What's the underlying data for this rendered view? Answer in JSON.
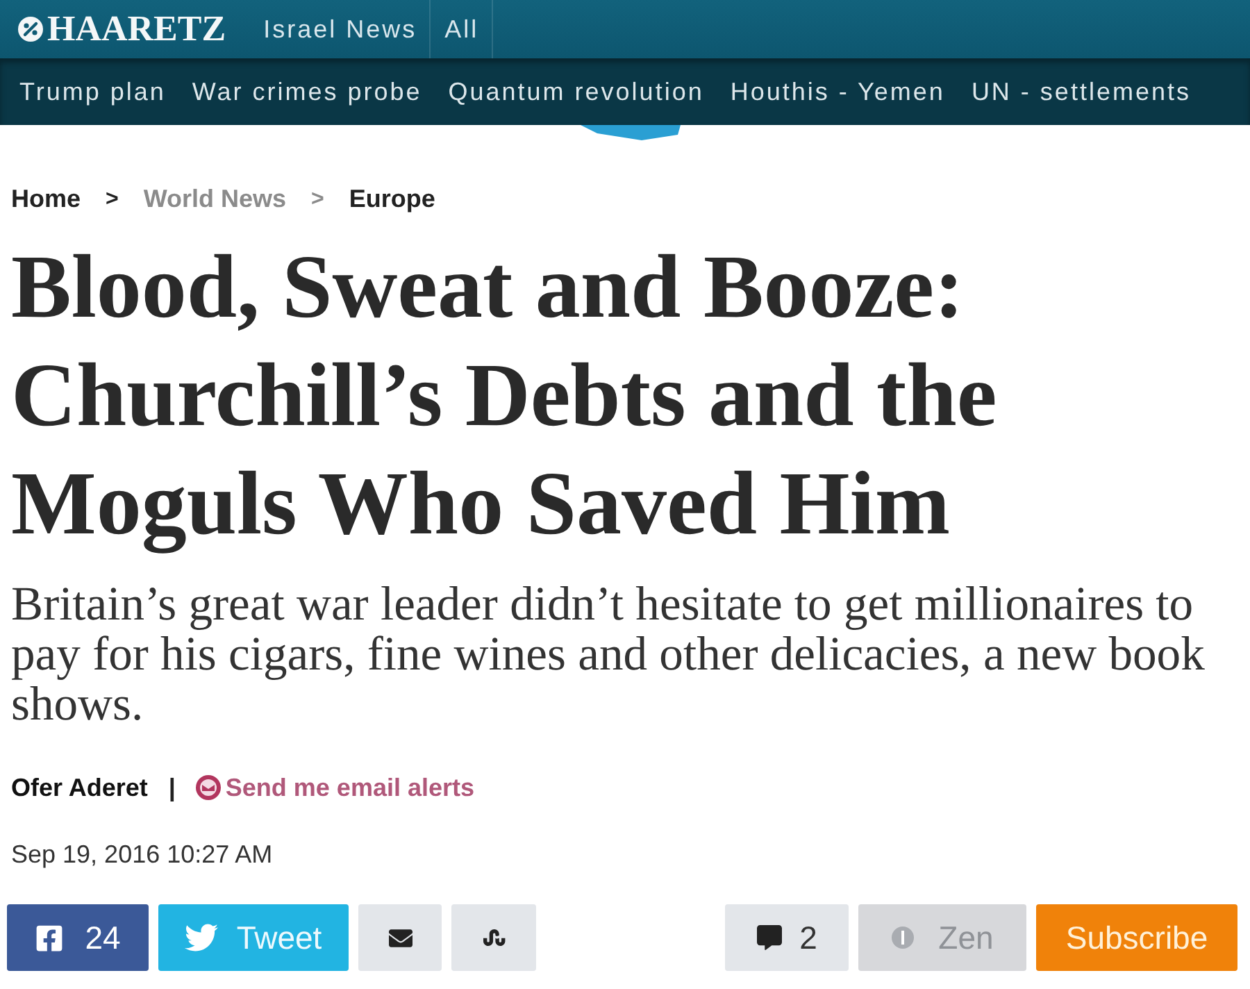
{
  "header": {
    "logo": "HAARETZ",
    "links": [
      {
        "label": "Israel News"
      },
      {
        "label": "All"
      }
    ]
  },
  "topics": [
    {
      "label": "Trump plan"
    },
    {
      "label": "War crimes probe"
    },
    {
      "label": "Quantum revolution"
    },
    {
      "label": "Houthis - Yemen"
    },
    {
      "label": "UN - settlements"
    }
  ],
  "breadcrumb": [
    {
      "kind": "link",
      "label": "Home",
      "muted": false
    },
    {
      "kind": "separator",
      "label": ">",
      "muted": false
    },
    {
      "kind": "link",
      "label": "World News",
      "muted": true
    },
    {
      "kind": "separator",
      "label": ">",
      "muted": true
    },
    {
      "kind": "link",
      "label": "Europe",
      "muted": false
    }
  ],
  "article": {
    "headline": "Blood, Sweat and Booze: Churchill’s Debts and the Moguls Who Saved Him",
    "subtitle": "Britain’s great war leader didn’t hesitate to get millionaires to pay for his cigars, fine wines and other delicacies, a new book shows.",
    "author": "Ofer Aderet",
    "separator": "|",
    "alert_link": "Send me email alerts",
    "date": "Sep 19, 2016 10:27 AM"
  },
  "share_buttons": [
    {
      "kind": "facebook",
      "label": "24"
    },
    {
      "kind": "twitter",
      "label": "Tweet"
    },
    {
      "kind": "email"
    },
    {
      "kind": "stumbleupon"
    }
  ],
  "tools": [
    {
      "kind": "comments",
      "label": "2"
    },
    {
      "kind": "zen",
      "label": "Zen",
      "disabled": true
    },
    {
      "kind": "subscribe",
      "label": "Subscribe"
    }
  ]
}
